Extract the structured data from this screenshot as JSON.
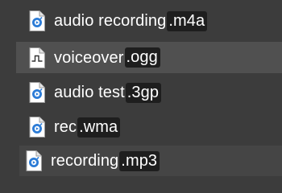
{
  "files": [
    {
      "base": "audio recording",
      "ext": ".m4a",
      "icon": "media-player-icon"
    },
    {
      "base": "voiceover",
      "ext": ".ogg",
      "icon": "audio-wave-icon"
    },
    {
      "base": "audio test",
      "ext": ".3gp",
      "icon": "media-player-icon"
    },
    {
      "base": "rec",
      "ext": ".wma",
      "icon": "media-player-icon"
    },
    {
      "base": "recording",
      "ext": ".mp3",
      "icon": "media-player-icon"
    }
  ],
  "colors": {
    "background": "#3c3c3c",
    "selected_row": "#505050",
    "hover_row": "#454545",
    "text": "#ffffff",
    "extension_highlight": "#1e1e1e",
    "media_icon_blue": "#2b7bd6"
  }
}
